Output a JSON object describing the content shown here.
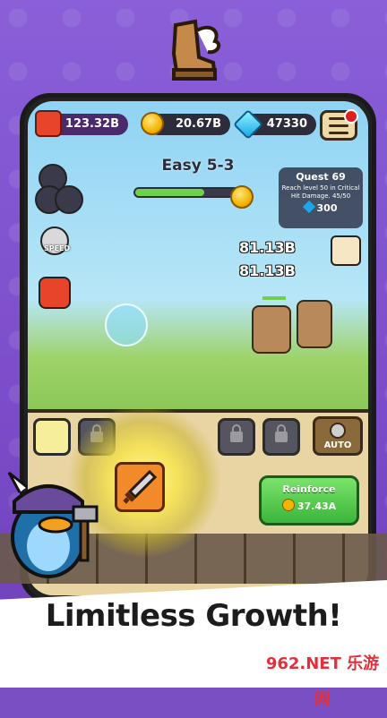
{
  "top": {
    "power": "123.32B",
    "gold": "20.67B",
    "gems": "47330"
  },
  "stage": {
    "label": "Easy 5-3",
    "progress": 0.66
  },
  "quest": {
    "title": "Quest 69",
    "desc": "Reach level 50 in Critical Hit Damage.",
    "progress_text": "45/50",
    "reward": "300"
  },
  "damage": [
    "81.13B",
    "81.13B"
  ],
  "speed_label": "SPEED",
  "auto_label": "AUTO",
  "reinforce": {
    "label": "Reinforce",
    "cost": "37.43A"
  },
  "tagline": "Limitless Growth!",
  "watermark": "962.NET 乐游网",
  "colors": {
    "background": "#7a4fc4",
    "reinforce": "#3bb53a",
    "gold": "#f5b400",
    "gem": "#1aa6e8"
  }
}
